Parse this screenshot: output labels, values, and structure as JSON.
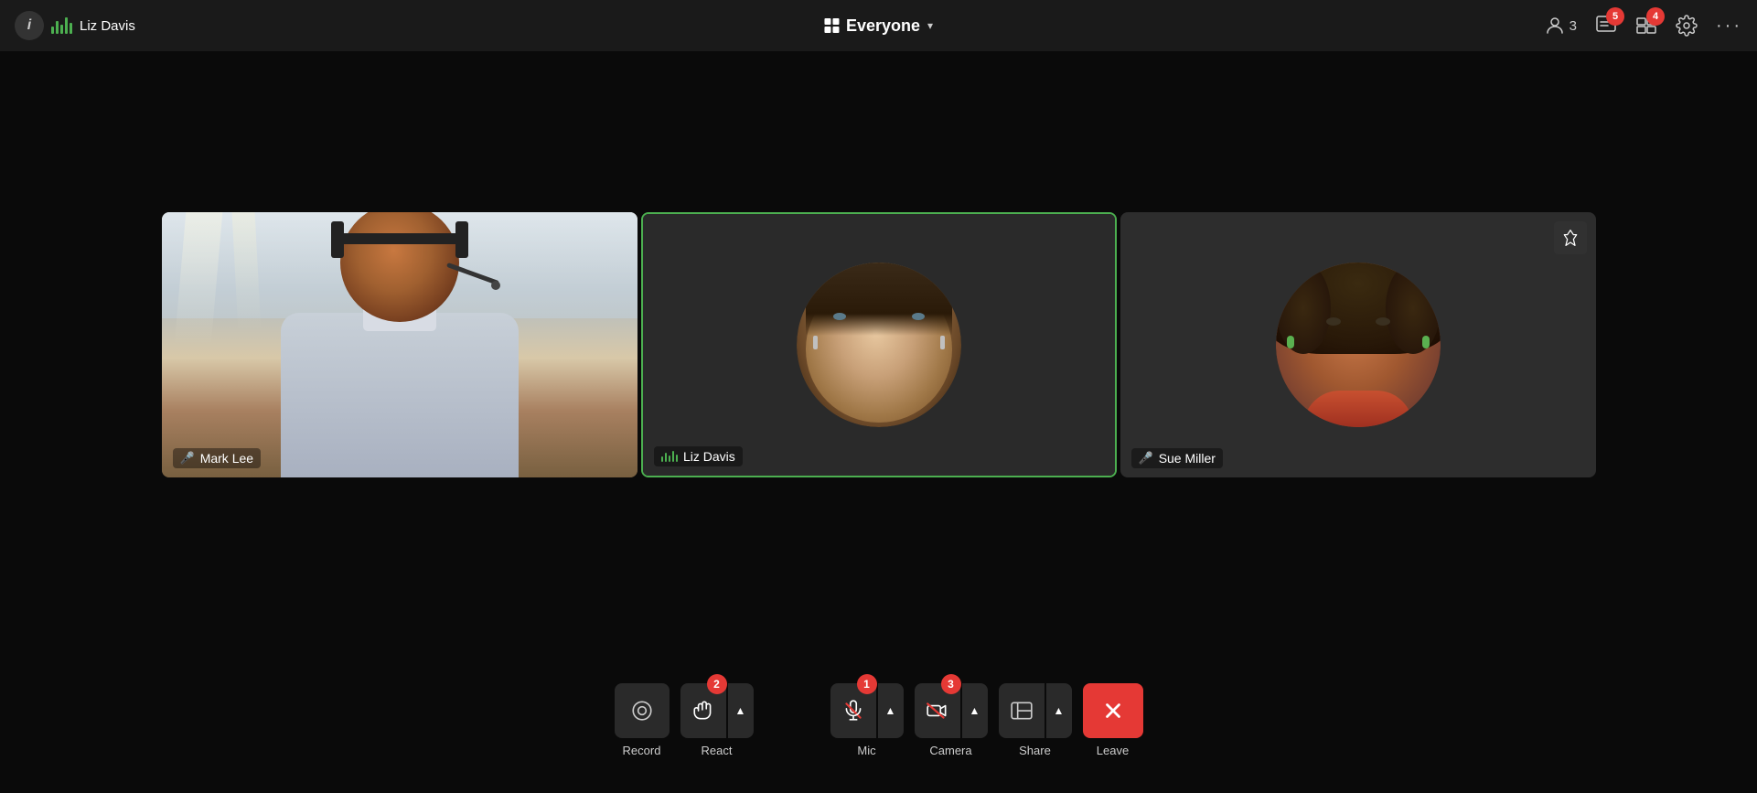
{
  "header": {
    "info_label": "i",
    "user_name": "Liz Davis",
    "everyone_label": "Everyone",
    "participant_count": "3",
    "notification_chat": "5",
    "notification_reactions": "4"
  },
  "tiles": [
    {
      "id": "mark-lee",
      "name": "Mark Lee",
      "muted": true,
      "speaking": false,
      "active": false
    },
    {
      "id": "liz-davis",
      "name": "Liz Davis",
      "muted": false,
      "speaking": true,
      "active": true
    },
    {
      "id": "sue-miller",
      "name": "Sue Miller",
      "muted": true,
      "speaking": false,
      "active": false,
      "pinnable": true
    }
  ],
  "toolbar": {
    "record_label": "Record",
    "react_label": "React",
    "mic_label": "Mic",
    "camera_label": "Camera",
    "share_label": "Share",
    "leave_label": "Leave",
    "badge_react": "2",
    "badge_mic": "1",
    "badge_camera": "3"
  }
}
